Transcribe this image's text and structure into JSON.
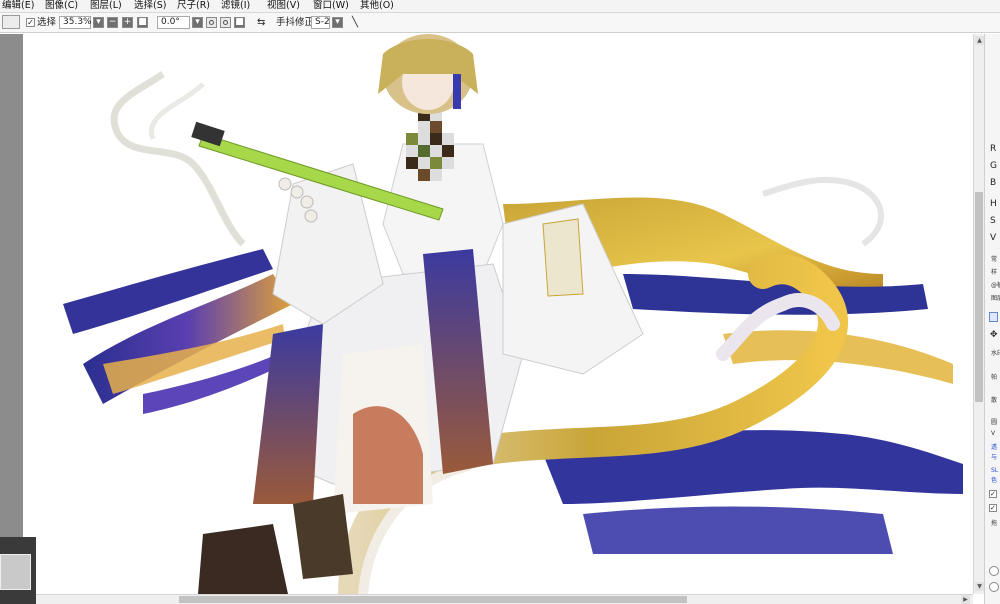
{
  "menu": {
    "items": [
      "编辑(E)",
      "图像(C)",
      "图层(L)",
      "选择(S)",
      "尺子(R)",
      "滤镜(I)",
      "视图(V)",
      "窗口(W)",
      "其他(O)"
    ]
  },
  "toolbar": {
    "select_label": "选择",
    "zoom_value": "35.3%",
    "rotation_value": "0.0°",
    "stabilizer_label": "手抖修正",
    "stabilizer_value": "S-2"
  },
  "right_panel": {
    "color_labels": [
      "R",
      "G",
      "B",
      "H",
      "S",
      "V"
    ],
    "small_text": [
      "常",
      "样",
      "@植",
      "图层",
      "水印",
      "帕",
      "散",
      "圆",
      "V",
      "透",
      "与",
      "SL",
      "色",
      "拖"
    ]
  },
  "colors": {
    "menubar_bg": "#f4f4f4",
    "canvas_bg": "#ffffff",
    "sidebar_bg": "#8c8c8c",
    "link_blue": "#2b4fd8"
  },
  "canvas": {
    "content": "illustration"
  }
}
